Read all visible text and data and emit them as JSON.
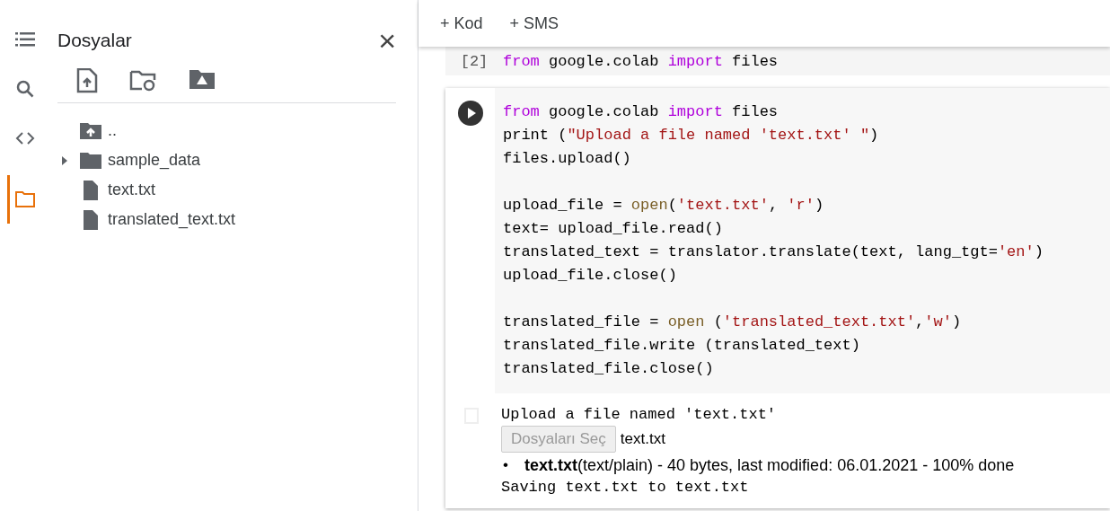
{
  "rail": [
    {
      "kind": "toc",
      "selected": false
    },
    {
      "kind": "search",
      "selected": false
    },
    {
      "kind": "code",
      "selected": false
    },
    {
      "kind": "files",
      "selected": true
    }
  ],
  "sidebar": {
    "title": "Dosyalar",
    "close": "×",
    "items": [
      {
        "kind": "parent",
        "label": ".."
      },
      {
        "kind": "folder",
        "label": "sample_data",
        "expanded": false
      },
      {
        "kind": "file",
        "label": "text.txt"
      },
      {
        "kind": "file",
        "label": "translated_text.txt"
      }
    ]
  },
  "toolbar": [
    "+ Kod",
    "+ SMS"
  ],
  "previous_cell": {
    "count": "[2]",
    "code": [
      {
        "kind": "kw",
        "text": "from"
      },
      {
        "kind": "plain",
        "text": " google.colab "
      },
      {
        "kind": "kw",
        "text": "import"
      },
      {
        "kind": "plain",
        "text": " files"
      }
    ]
  },
  "cell": {
    "code_blocks": [
      [
        [
          {
            "kind": "kw",
            "text": "from"
          },
          {
            "kind": "plain",
            "text": " google.colab "
          },
          {
            "kind": "kw",
            "text": "import"
          },
          {
            "kind": "plain",
            "text": " files"
          }
        ],
        [
          {
            "kind": "plain",
            "text": "print ("
          },
          {
            "kind": "str",
            "text": "\"Upload a file named 'text.txt' \""
          },
          {
            "kind": "plain",
            "text": ")"
          }
        ],
        [
          {
            "kind": "plain",
            "text": "files.upload()"
          }
        ]
      ],
      [
        [
          {
            "kind": "plain",
            "text": "upload_file = "
          },
          {
            "kind": "fn",
            "text": "open"
          },
          {
            "kind": "plain",
            "text": "("
          },
          {
            "kind": "str",
            "text": "'text.txt'"
          },
          {
            "kind": "plain",
            "text": ", "
          },
          {
            "kind": "str",
            "text": "'r'"
          },
          {
            "kind": "plain",
            "text": ")"
          }
        ],
        [
          {
            "kind": "plain",
            "text": "text= upload_file.read()"
          }
        ],
        [
          {
            "kind": "plain",
            "text": "translated_text = translator.translate(text, lang_tgt="
          },
          {
            "kind": "str",
            "text": "'en'"
          },
          {
            "kind": "plain",
            "text": ")"
          }
        ],
        [
          {
            "kind": "plain",
            "text": "upload_file.close()"
          }
        ]
      ],
      [
        [
          {
            "kind": "plain",
            "text": "translated_file = "
          },
          {
            "kind": "fn",
            "text": "open"
          },
          {
            "kind": "plain",
            "text": " ("
          },
          {
            "kind": "str",
            "text": "'translated_text.txt'"
          },
          {
            "kind": "plain",
            "text": ","
          },
          {
            "kind": "str",
            "text": "'w'"
          },
          {
            "kind": "plain",
            "text": ")"
          }
        ],
        [
          {
            "kind": "plain",
            "text": "translated_file.write (translated_text)"
          }
        ],
        [
          {
            "kind": "plain",
            "text": "translated_file.close()"
          }
        ]
      ]
    ],
    "output": {
      "prompt": "Upload a file named 'text.txt'",
      "button": "Dosyaları Seç",
      "chosen": "text.txt",
      "bullet": "•",
      "status": "**text.txt**(text/plain) - 40 bytes, last modified: 06.01.2021 - 100% done",
      "saving": "Saving text.txt to text.txt"
    }
  }
}
